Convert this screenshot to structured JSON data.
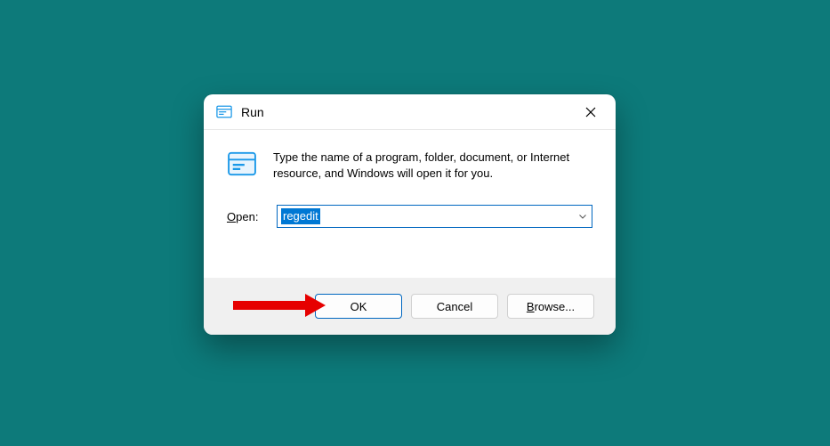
{
  "dialog": {
    "title": "Run",
    "message": "Type the name of a program, folder, document, or Internet resource, and Windows will open it for you.",
    "open_label_char": "O",
    "open_label_rest": "pen:",
    "input_value": "regedit",
    "buttons": {
      "ok": "OK",
      "cancel": "Cancel",
      "browse_char": "B",
      "browse_rest": "rowse..."
    }
  }
}
